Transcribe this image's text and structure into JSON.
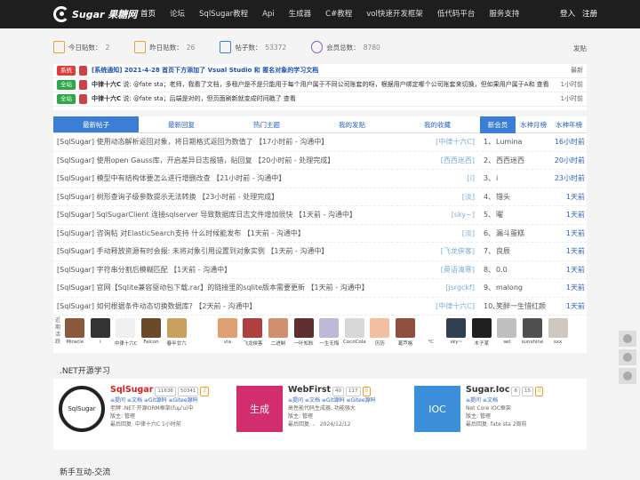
{
  "logo": {
    "text": "Sugar 果糖网"
  },
  "nav": [
    "首页",
    "论坛",
    "SqlSugar教程",
    "Api",
    "生成器",
    "C#教程",
    "vol快速开发框架",
    "低代码平台",
    "服务支持"
  ],
  "user": {
    "login": "登入",
    "register": "注册"
  },
  "stats": [
    {
      "label": "今日贴数：",
      "value": "2"
    },
    {
      "label": "昨日贴数：",
      "value": "26"
    },
    {
      "label": "帖子数：",
      "value": "53372"
    },
    {
      "label": "会员总数：",
      "value": "8780"
    }
  ],
  "post_button": "发贴",
  "notices": [
    {
      "tag": "系统",
      "title": "[系统通知] 2021-4-28 首页下方添加了 Vsual Studio 和 匿名对象的学习文档",
      "time": "最新"
    },
    {
      "tag": "全站",
      "author": "中律十六C",
      "text": "说: @fate sta；老师，我看了文档，多租户是不是只能用于每个用户属于不同公司账套的呀，根据用户绑定哪个公司账套来切换，但如果用户属于A和 查看",
      "time": "1小时前"
    },
    {
      "tag": "全站",
      "author": "中律十六C",
      "text": "说: @fate sta；后端是对的，但页面刷新就变成时间戳了 查看",
      "time": "1小时前"
    }
  ],
  "tabs": [
    "最新帖子",
    "最新回复",
    "热门主题",
    "我的发贴",
    "我的收藏"
  ],
  "rank_tabs": [
    "新会员",
    "水神月榜",
    "水神年榜"
  ],
  "posts": [
    {
      "title": "[SqlSugar] 使用动态解析返回对象，将日期格式返回为数值了 【17小时前 - 沟通中】",
      "author": "[中律十六C]"
    },
    {
      "title": "[SqlSugar] 使用open Gauss库，开启差异日志报错，贴回复 【20小时前 - 处理完成】",
      "author": "[西西迷西]"
    },
    {
      "title": "[SqlSugar] 模型中有结构体要怎么进行增删改查 【21小时前 - 沟通中】",
      "author": "[i]"
    },
    {
      "title": "[SqlSugar] 树形查询子级参数提示无法转换 【23小时前 - 处理完成】",
      "author": "[淡]"
    },
    {
      "title": "[SqlSugar] SqlSugarClient 连接sqlserver 导致数据库日志文件增加很快 【1天前 - 沟通中】",
      "author": "[sky~]"
    },
    {
      "title": "[SqlSugar] 咨询帖 对ElasticSearch支持 什么时候能发布 【1天前 - 沟通中】",
      "author": "[淡]"
    },
    {
      "title": "[SqlSugar] 手动释放资源有时会报: 未将对象引用设置到对象实例 【1天前 - 沟通中】",
      "author": "[飞龙侠客]"
    },
    {
      "title": "[SqlSugar] 字符串分割后模糊匹配 【1天前 - 沟通中】",
      "author": "[莫语清寒]"
    },
    {
      "title": "[SqlSugar] 官网【Sqlite兼容驱动包下载.rar】的链接里的sqlite版本需要更新 【1天前 - 沟通中】",
      "author": "[jsrgckf]"
    },
    {
      "title": "[SqlSugar] 如何根据条件动态切换数据库? 【2天前 - 沟通中】",
      "author": "[中律十六C]"
    }
  ],
  "rank": [
    {
      "n": "1、",
      "name": "Lumina",
      "time": "16小时前"
    },
    {
      "n": "2、",
      "name": "西西迷西",
      "time": "20小时前"
    },
    {
      "n": "3、",
      "name": "i",
      "time": "23小时前"
    },
    {
      "n": "4、",
      "name": "错头",
      "time": "1天前"
    },
    {
      "n": "5、",
      "name": "曜",
      "time": "1天前"
    },
    {
      "n": "6、",
      "name": "漏斗蛋糕",
      "time": "1天前"
    },
    {
      "n": "7、",
      "name": "良辰",
      "time": "1天前"
    },
    {
      "n": "8、",
      "name": "0.0",
      "time": "1天前"
    },
    {
      "n": "9、",
      "name": "malong",
      "time": "1天前"
    },
    {
      "n": "10、",
      "name": "笑醉一生惜红颜",
      "time": "1天前"
    }
  ],
  "avatar_label": "近期活跃",
  "avatars": [
    {
      "name": "Miracle",
      "color": "#8b5a3c"
    },
    {
      "name": "i",
      "color": "#333333"
    },
    {
      "name": "中律十六C",
      "color": "#f0f0f0"
    },
    {
      "name": "Falcon",
      "color": "#6a4a2a"
    },
    {
      "name": "春半廿六",
      "color": "#c8a060"
    },
    {
      "name": "",
      "color": "#ffffff"
    },
    {
      "name": "via",
      "color": "#e0a070"
    },
    {
      "name": "飞龙侠客",
      "color": "#b04040"
    },
    {
      "name": "二进制",
      "color": "#d09070"
    },
    {
      "name": "一叶知秋",
      "color": "#603030"
    },
    {
      "name": "一生无悔",
      "color": "#c0b8d8"
    },
    {
      "name": "CocoCola",
      "color": "#d8d8d8"
    },
    {
      "name": "历历",
      "color": "#f0c0a0"
    },
    {
      "name": "葛芦格",
      "color": "#905040"
    },
    {
      "name": "°C",
      "color": "#ffffff"
    },
    {
      "name": "sky~",
      "color": "#304050"
    },
    {
      "name": "木子某",
      "color": "#202020"
    },
    {
      "name": "set",
      "color": "#c0c0c0"
    },
    {
      "name": "sunshine",
      "color": "#505050"
    },
    {
      "name": "sxx",
      "color": "#d0c8c0"
    }
  ],
  "section1": ".NET开源学习",
  "cards": [
    {
      "name": "SqlSugar",
      "views": "11636",
      "posts": "50341",
      "new": "2",
      "links": "≡提问  ≡文档  ≡Git源码  ≡Gitee源码",
      "desc": "老牌 .NET 开源ORM框架(fuµ'u)中",
      "mod": "版主: 管理",
      "last": "最后回复: 中律十六C  1小时前",
      "logo_color": "#ffffff",
      "logo_text": "SqlSugar"
    },
    {
      "name": "WebFirst",
      "views": "40",
      "posts": "117",
      "new": "0",
      "links": "≡提问  ≡文档  ≡Git源码  ≡Gitee源码",
      "desc": "高性能代码生成器, 功能强大",
      "mod": "版主: 管理",
      "last": "最后回复: 、  2024/12/12",
      "logo_color": "#d22d6e",
      "logo_text": "生成"
    },
    {
      "name": "Sugar.Ioc",
      "views": "6",
      "posts": "15",
      "new": "0",
      "links": "≡提问  ≡文档",
      "desc": "Net Core IOC框架",
      "mod": "版主: 管理",
      "last": "最后回复: fate sta  2周前",
      "logo_color": "#3b8ed8",
      "logo_text": "IOC"
    }
  ],
  "section2": "新手互动-交流"
}
